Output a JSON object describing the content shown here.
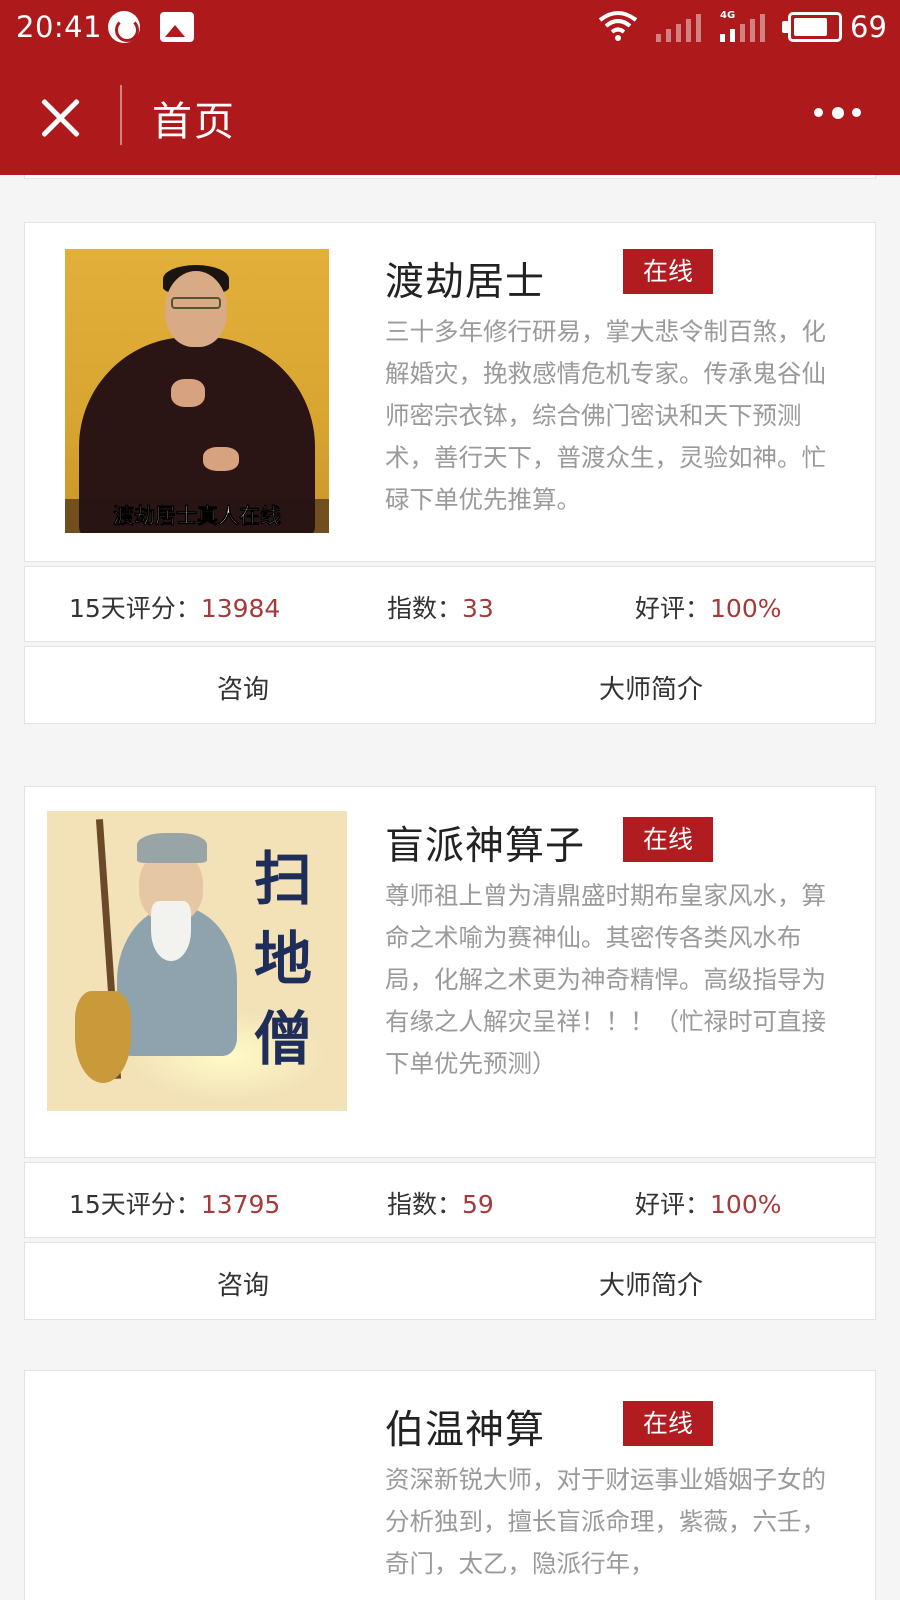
{
  "status_bar": {
    "time": "20:41",
    "network": "4G",
    "battery": "69",
    "battery_level_percent": 69
  },
  "nav": {
    "title": "首页",
    "close_icon": "close-icon",
    "more_icon": "more-dots-icon"
  },
  "colors": {
    "brand_red": "#ae1a1c",
    "value_red": "#a63a3a",
    "description_gray": "#9a9a9a"
  },
  "masters": [
    {
      "name": "渡劫居士",
      "status": "在线",
      "avatar_caption": "渡劫居士真人在线",
      "description": "三十多年修行研易，掌大悲令制百煞，化解婚灾，挽救感情危机专家。传承鬼谷仙师密宗衣钵，综合佛门密诀和天下预测术，善行天下，普渡众生，灵验如神。忙碌下单优先推算。",
      "rating_label": "15天评分：",
      "rating_value": "13984",
      "index_label": "指数：",
      "index_value": "33",
      "praise_label": "好评：",
      "praise_value": "100%",
      "consult_label": "咨询",
      "intro_label": "大师简介"
    },
    {
      "name": "盲派神算子",
      "status": "在线",
      "avatar_caption": "扫地僧",
      "description": "尊师祖上曾为清鼎盛时期布皇家风水，算命之术喻为赛神仙。其密传各类风水布局，化解之术更为神奇精悍。高级指导为有缘之人解灾呈祥！！！（忙禄时可直接下单优先预测）",
      "rating_label": "15天评分：",
      "rating_value": "13795",
      "index_label": "指数：",
      "index_value": "59",
      "praise_label": "好评：",
      "praise_value": "100%",
      "consult_label": "咨询",
      "intro_label": "大师简介"
    },
    {
      "name": "伯温神算",
      "status": "在线",
      "description": "资深新锐大师，对于财运事业婚姻子女的分析独到，擅长盲派命理，紫薇，六壬，奇门，太乙，隐派行年，"
    }
  ]
}
